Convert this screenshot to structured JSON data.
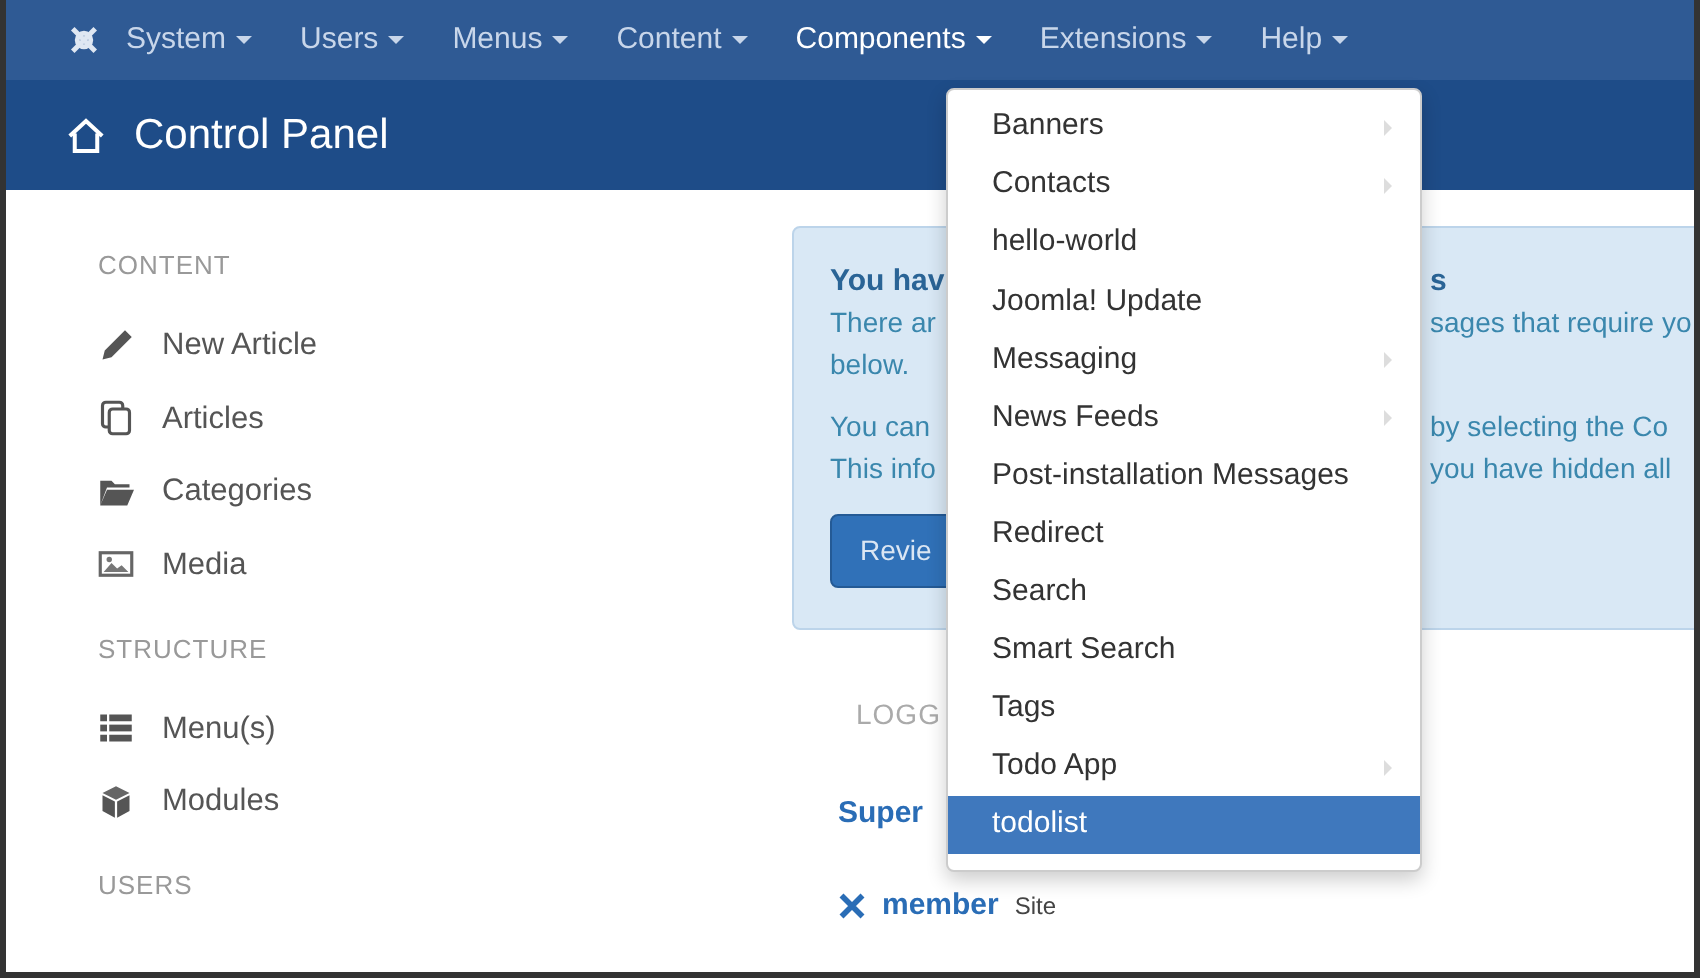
{
  "menubar": {
    "items": [
      {
        "label": "System",
        "selected": false
      },
      {
        "label": "Users",
        "selected": false
      },
      {
        "label": "Menus",
        "selected": false
      },
      {
        "label": "Content",
        "selected": false
      },
      {
        "label": "Components",
        "selected": true
      },
      {
        "label": "Extensions",
        "selected": false
      },
      {
        "label": "Help",
        "selected": false
      }
    ]
  },
  "header": {
    "title": "Control Panel"
  },
  "sidebar": {
    "sections": [
      {
        "heading": "CONTENT",
        "items": [
          {
            "label": "New Article"
          },
          {
            "label": "Articles"
          },
          {
            "label": "Categories"
          },
          {
            "label": "Media"
          }
        ]
      },
      {
        "heading": "STRUCTURE",
        "items": [
          {
            "label": "Menu(s)"
          },
          {
            "label": "Modules"
          }
        ]
      },
      {
        "heading": "USERS"
      }
    ]
  },
  "alert": {
    "lines": [
      {
        "kind": "heading",
        "left": "You hav",
        "right": "s"
      },
      {
        "kind": "text",
        "left": "There ar",
        "right": "sages that require yo"
      },
      {
        "kind": "text",
        "left": "below."
      },
      {
        "kind": "gap"
      },
      {
        "kind": "text",
        "left": "You can",
        "right": "by selecting the Co"
      },
      {
        "kind": "text",
        "left": "This info",
        "right": "you have hidden all"
      }
    ],
    "button": "Revie"
  },
  "logged_in": {
    "heading": "LOGG",
    "user": "Super",
    "rows": [
      {
        "name": "member",
        "location": "Site"
      }
    ]
  },
  "dropdown": {
    "items": [
      {
        "label": "Banners",
        "submenu": true,
        "selected": false
      },
      {
        "label": "Contacts",
        "submenu": true,
        "selected": false
      },
      {
        "label": "hello-world",
        "submenu": false,
        "selected": false
      },
      {
        "label": "Joomla! Update",
        "submenu": false,
        "selected": false
      },
      {
        "label": "Messaging",
        "submenu": true,
        "selected": false
      },
      {
        "label": "News Feeds",
        "submenu": true,
        "selected": false
      },
      {
        "label": "Post-installation Messages",
        "submenu": false,
        "selected": false
      },
      {
        "label": "Redirect",
        "submenu": false,
        "selected": false
      },
      {
        "label": "Search",
        "submenu": false,
        "selected": false
      },
      {
        "label": "Smart Search",
        "submenu": false,
        "selected": false
      },
      {
        "label": "Tags",
        "submenu": false,
        "selected": false
      },
      {
        "label": "Todo App",
        "submenu": true,
        "selected": false
      },
      {
        "label": "todolist",
        "submenu": false,
        "selected": true
      }
    ]
  }
}
